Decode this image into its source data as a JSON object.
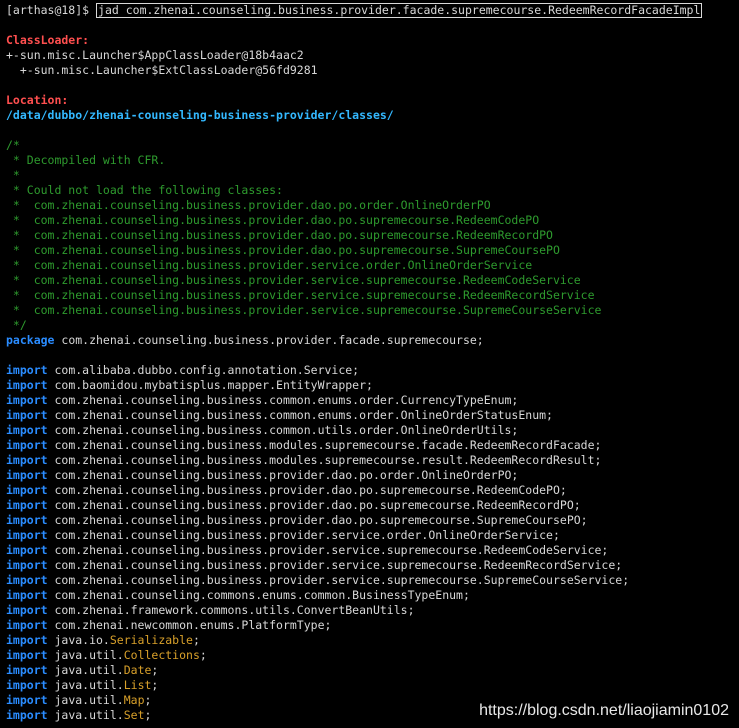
{
  "prompt": "[arthas@18]$",
  "command": "jad com.zhenai.counseling.business.provider.facade.supremecourse.RedeemRecordFacadeImpl",
  "classloader": {
    "label": "ClassLoader:",
    "lines": [
      "+-sun.misc.Launcher$AppClassLoader@18b4aac2",
      "  +-sun.misc.Launcher$ExtClassLoader@56fd9281"
    ]
  },
  "location": {
    "label": "Location:",
    "path": "/data/dubbo/zhenai-counseling-business-provider/classes/"
  },
  "comment_lines": [
    "/*",
    " * Decompiled with CFR.",
    " *",
    " * Could not load the following classes:",
    " *  com.zhenai.counseling.business.provider.dao.po.order.OnlineOrderPO",
    " *  com.zhenai.counseling.business.provider.dao.po.supremecourse.RedeemCodePO",
    " *  com.zhenai.counseling.business.provider.dao.po.supremecourse.RedeemRecordPO",
    " *  com.zhenai.counseling.business.provider.dao.po.supremecourse.SupremeCoursePO",
    " *  com.zhenai.counseling.business.provider.service.order.OnlineOrderService",
    " *  com.zhenai.counseling.business.provider.service.supremecourse.RedeemCodeService",
    " *  com.zhenai.counseling.business.provider.service.supremecourse.RedeemRecordService",
    " *  com.zhenai.counseling.business.provider.service.supremecourse.SupremeCourseService",
    " */"
  ],
  "package_line": {
    "keyword": "package",
    "name": " com.zhenai.counseling.business.provider.facade.supremecourse;"
  },
  "import_keyword": "import",
  "imports": [
    {
      "name": " com.alibaba.dubbo.config.annotation.Service;"
    },
    {
      "name": " com.baomidou.mybatisplus.mapper.EntityWrapper;"
    },
    {
      "name": " com.zhenai.counseling.business.common.enums.order.CurrencyTypeEnum;"
    },
    {
      "name": " com.zhenai.counseling.business.common.enums.order.OnlineOrderStatusEnum;"
    },
    {
      "name": " com.zhenai.counseling.business.common.utils.order.OnlineOrderUtils;"
    },
    {
      "name": " com.zhenai.counseling.business.modules.supremecourse.facade.RedeemRecordFacade;"
    },
    {
      "name": " com.zhenai.counseling.business.modules.supremecourse.result.RedeemRecordResult;"
    },
    {
      "name": " com.zhenai.counseling.business.provider.dao.po.order.OnlineOrderPO;"
    },
    {
      "name": " com.zhenai.counseling.business.provider.dao.po.supremecourse.RedeemCodePO;"
    },
    {
      "name": " com.zhenai.counseling.business.provider.dao.po.supremecourse.RedeemRecordPO;"
    },
    {
      "name": " com.zhenai.counseling.business.provider.dao.po.supremecourse.SupremeCoursePO;"
    },
    {
      "name": " com.zhenai.counseling.business.provider.service.order.OnlineOrderService;"
    },
    {
      "name": " com.zhenai.counseling.business.provider.service.supremecourse.RedeemCodeService;"
    },
    {
      "name": " com.zhenai.counseling.business.provider.service.supremecourse.RedeemRecordService;"
    },
    {
      "name": " com.zhenai.counseling.business.provider.service.supremecourse.SupremeCourseService;"
    },
    {
      "name": " com.zhenai.counseling.commons.enums.common.BusinessTypeEnum;"
    },
    {
      "name": " com.zhenai.framework.commons.utils.ConvertBeanUtils;"
    },
    {
      "name": " com.zhenai.newcommon.enums.PlatformType;"
    },
    {
      "name": " java.io.",
      "cls": "Serializable",
      "end": ";"
    },
    {
      "name": " java.util.",
      "cls": "Collections",
      "end": ";"
    },
    {
      "name": " java.util.",
      "cls": "Date",
      "end": ";"
    },
    {
      "name": " java.util.",
      "cls": "List",
      "end": ";"
    },
    {
      "name": " java.util.",
      "cls": "Map",
      "end": ";"
    },
    {
      "name": " java.util.",
      "cls": "Set",
      "end": ";"
    }
  ],
  "watermark": "https://blog.csdn.net/liaojiamin0102",
  "colors": {
    "background": "#000000",
    "text": "#d8d8d8",
    "label_red": "#ff4f4f",
    "path_blue": "#33b8ff",
    "comment_green": "#2e9b2e",
    "keyword_blue": "#2a8cff",
    "class_orange": "#d8a02a"
  }
}
